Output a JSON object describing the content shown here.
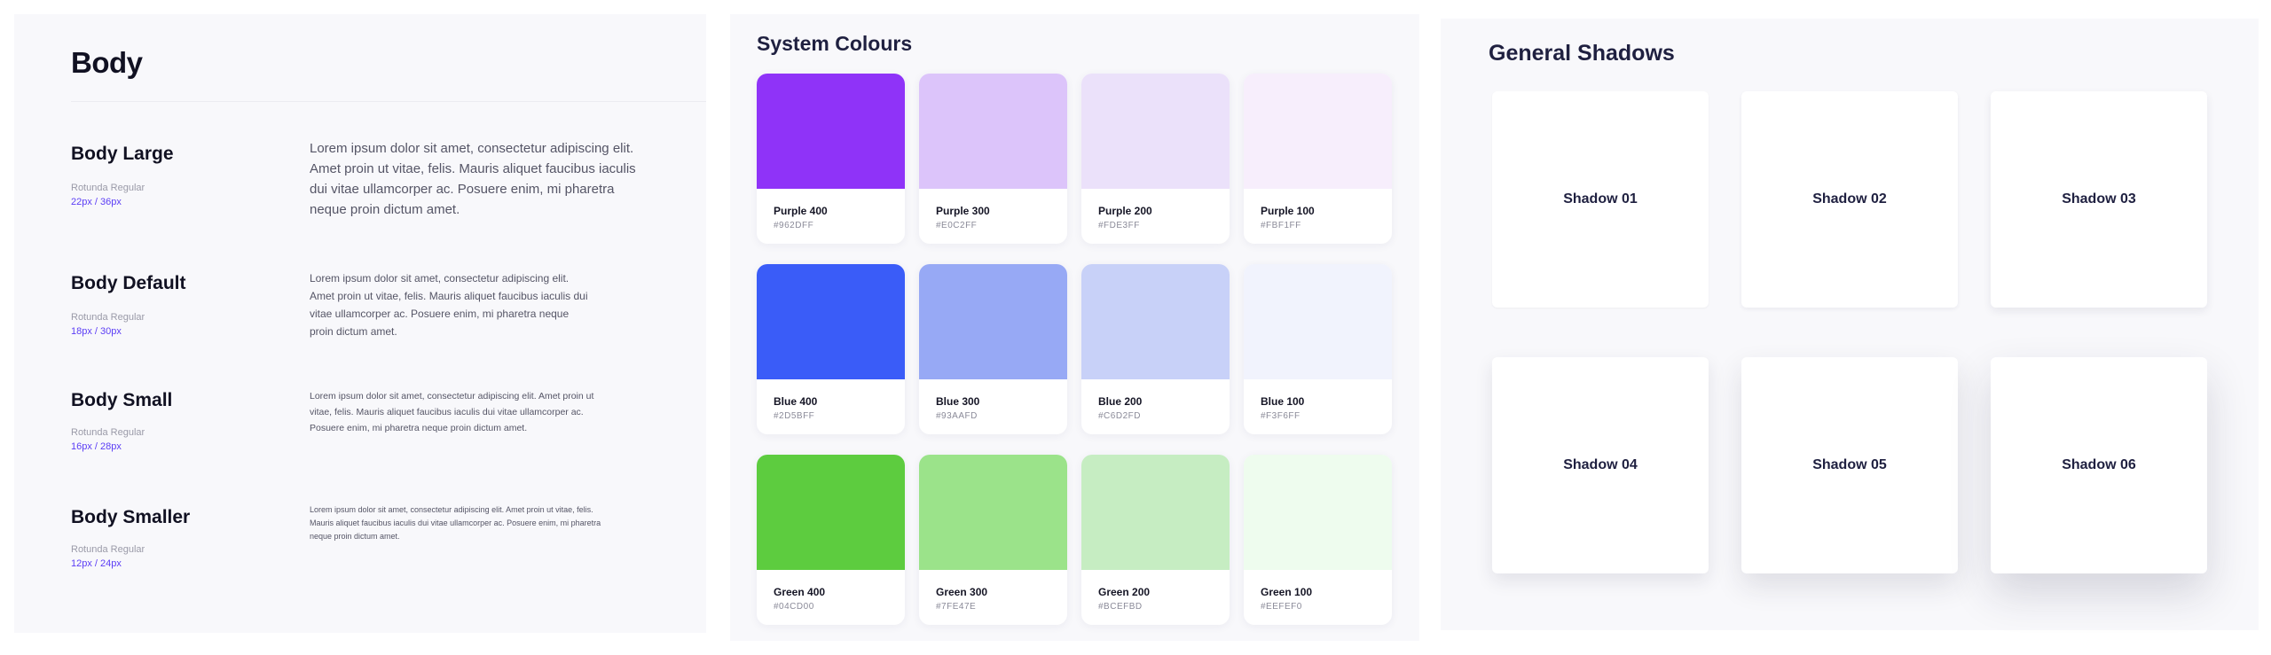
{
  "body_panel": {
    "heading": "Body",
    "rows": [
      {
        "name": "Body Large",
        "font": "Rotunda Regular",
        "size": "22px / 36px",
        "sample": "Lorem ipsum dolor sit amet, consectetur adipiscing elit. Amet proin ut vitae, felis. Mauris aliquet faucibus iaculis dui vitae ullamcorper ac. Posuere enim, mi pharetra neque proin dictum amet."
      },
      {
        "name": "Body Default",
        "font": "Rotunda Regular",
        "size": "18px / 30px",
        "sample": "Lorem ipsum dolor sit amet, consectetur adipiscing elit. Amet proin ut vitae, felis. Mauris aliquet faucibus iaculis dui vitae ullamcorper ac. Posuere enim, mi pharetra neque proin dictum amet."
      },
      {
        "name": "Body Small",
        "font": "Rotunda Regular",
        "size": "16px / 28px",
        "sample": "Lorem ipsum dolor sit amet, consectetur adipiscing elit. Amet proin ut vitae, felis. Mauris aliquet faucibus iaculis dui vitae ullamcorper ac. Posuere enim, mi pharetra neque proin dictum amet."
      },
      {
        "name": "Body Smaller",
        "font": "Rotunda Regular",
        "size": "12px / 24px",
        "sample": "Lorem ipsum dolor sit amet, consectetur adipiscing elit. Amet proin ut vitae, felis. Mauris aliquet faucibus iaculis dui vitae ullamcorper ac. Posuere enim, mi pharetra neque proin dictum amet."
      }
    ]
  },
  "colours_panel": {
    "heading": "System Colours",
    "swatches": [
      {
        "name": "Purple 400",
        "hex": "#962DFF",
        "color": "#8f33f8"
      },
      {
        "name": "Purple 300",
        "hex": "#E0C2FF",
        "color": "#dcc4fa"
      },
      {
        "name": "Purple 200",
        "hex": "#FDE3FF",
        "color": "#ebe1fa"
      },
      {
        "name": "Purple 100",
        "hex": "#FBF1FF",
        "color": "#f7eefc"
      },
      {
        "name": "Blue 400",
        "hex": "#2D5BFF",
        "color": "#3a5cf8"
      },
      {
        "name": "Blue 300",
        "hex": "#93AAFD",
        "color": "#97a9f5"
      },
      {
        "name": "Blue 200",
        "hex": "#C6D2FD",
        "color": "#c8d1f8"
      },
      {
        "name": "Blue 100",
        "hex": "#F3F6FF",
        "color": "#f1f3fd"
      },
      {
        "name": "Green 400",
        "hex": "#04CD00",
        "color": "#5dcc3f"
      },
      {
        "name": "Green 300",
        "hex": "#7FE47E",
        "color": "#9be38a"
      },
      {
        "name": "Green 200",
        "hex": "#BCEFBD",
        "color": "#c6edc2"
      },
      {
        "name": "Green 100",
        "hex": "#EEFEF0",
        "color": "#eefcee"
      }
    ]
  },
  "shadows_panel": {
    "heading": "General Shadows",
    "cards": [
      {
        "label": "Shadow 01"
      },
      {
        "label": "Shadow 02"
      },
      {
        "label": "Shadow 03"
      },
      {
        "label": "Shadow 04"
      },
      {
        "label": "Shadow 05"
      },
      {
        "label": "Shadow 06"
      }
    ]
  },
  "colors": {
    "accent": "#5b3df5",
    "heading": "#1f2040",
    "panel_bg": "#f8f8fb"
  }
}
